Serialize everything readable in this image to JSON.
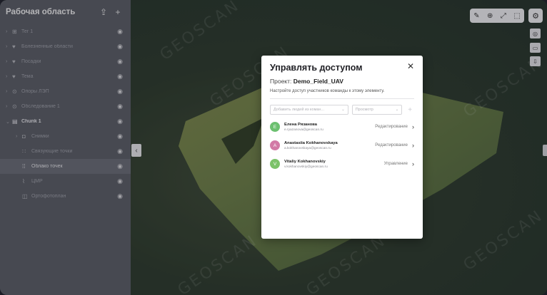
{
  "sidebar": {
    "title": "Рабочая область",
    "items": [
      {
        "label": "Тег 1",
        "icon": "table-icon",
        "glyph": "⊞"
      },
      {
        "label": "Болезненные области",
        "icon": "heart-icon",
        "glyph": "♥"
      },
      {
        "label": "Посадки",
        "icon": "heart-icon",
        "glyph": "♥"
      },
      {
        "label": "Тема",
        "icon": "heart-icon",
        "glyph": "♥"
      },
      {
        "label": "Опоры ЛЭП",
        "icon": "pin-icon",
        "glyph": "⊙"
      },
      {
        "label": "Обследование 1",
        "icon": "pin-icon",
        "glyph": "⊙"
      },
      {
        "label": "Chunk 1",
        "icon": "chunk-icon",
        "glyph": "▤"
      },
      {
        "label": "Снимки",
        "icon": "camera-icon",
        "glyph": "◘"
      },
      {
        "label": "Связующие точки",
        "icon": "tiepoints-icon",
        "glyph": "∷"
      },
      {
        "label": "Облако точек",
        "icon": "pointcloud-icon",
        "glyph": "⁞⁞"
      },
      {
        "label": "ЦМР",
        "icon": "dem-icon",
        "glyph": "⌇"
      },
      {
        "label": "Ортофотоплан",
        "icon": "orthophoto-icon",
        "glyph": "◫"
      }
    ]
  },
  "watermark": "GEOSCAN",
  "modal": {
    "title": "Управлять доступом",
    "project_label": "Проект:",
    "project_name": "Demo_Field_UAV",
    "description": "Настройте доступ участников команды к этому элементу.",
    "add_people_placeholder": "Добавить людей из коман...",
    "role_placeholder": "Просмотр",
    "users": [
      {
        "initial": "Е",
        "name": "Елена Рязанова",
        "email": "e.ryazanova@geoscan.ru",
        "role": "Редактирование",
        "color": "#6cc070"
      },
      {
        "initial": "А",
        "name": "Anastasiia Kokhanovskaya",
        "email": "a.kokhanovskaya@geoscan.ru",
        "role": "Редактирование",
        "color": "#d27aa6"
      },
      {
        "initial": "V",
        "name": "Vitaliy Kokhanovskiy",
        "email": "v.kokhanovskiy@geoscan.ru",
        "role": "Управление",
        "color": "#7cc26a"
      }
    ]
  }
}
